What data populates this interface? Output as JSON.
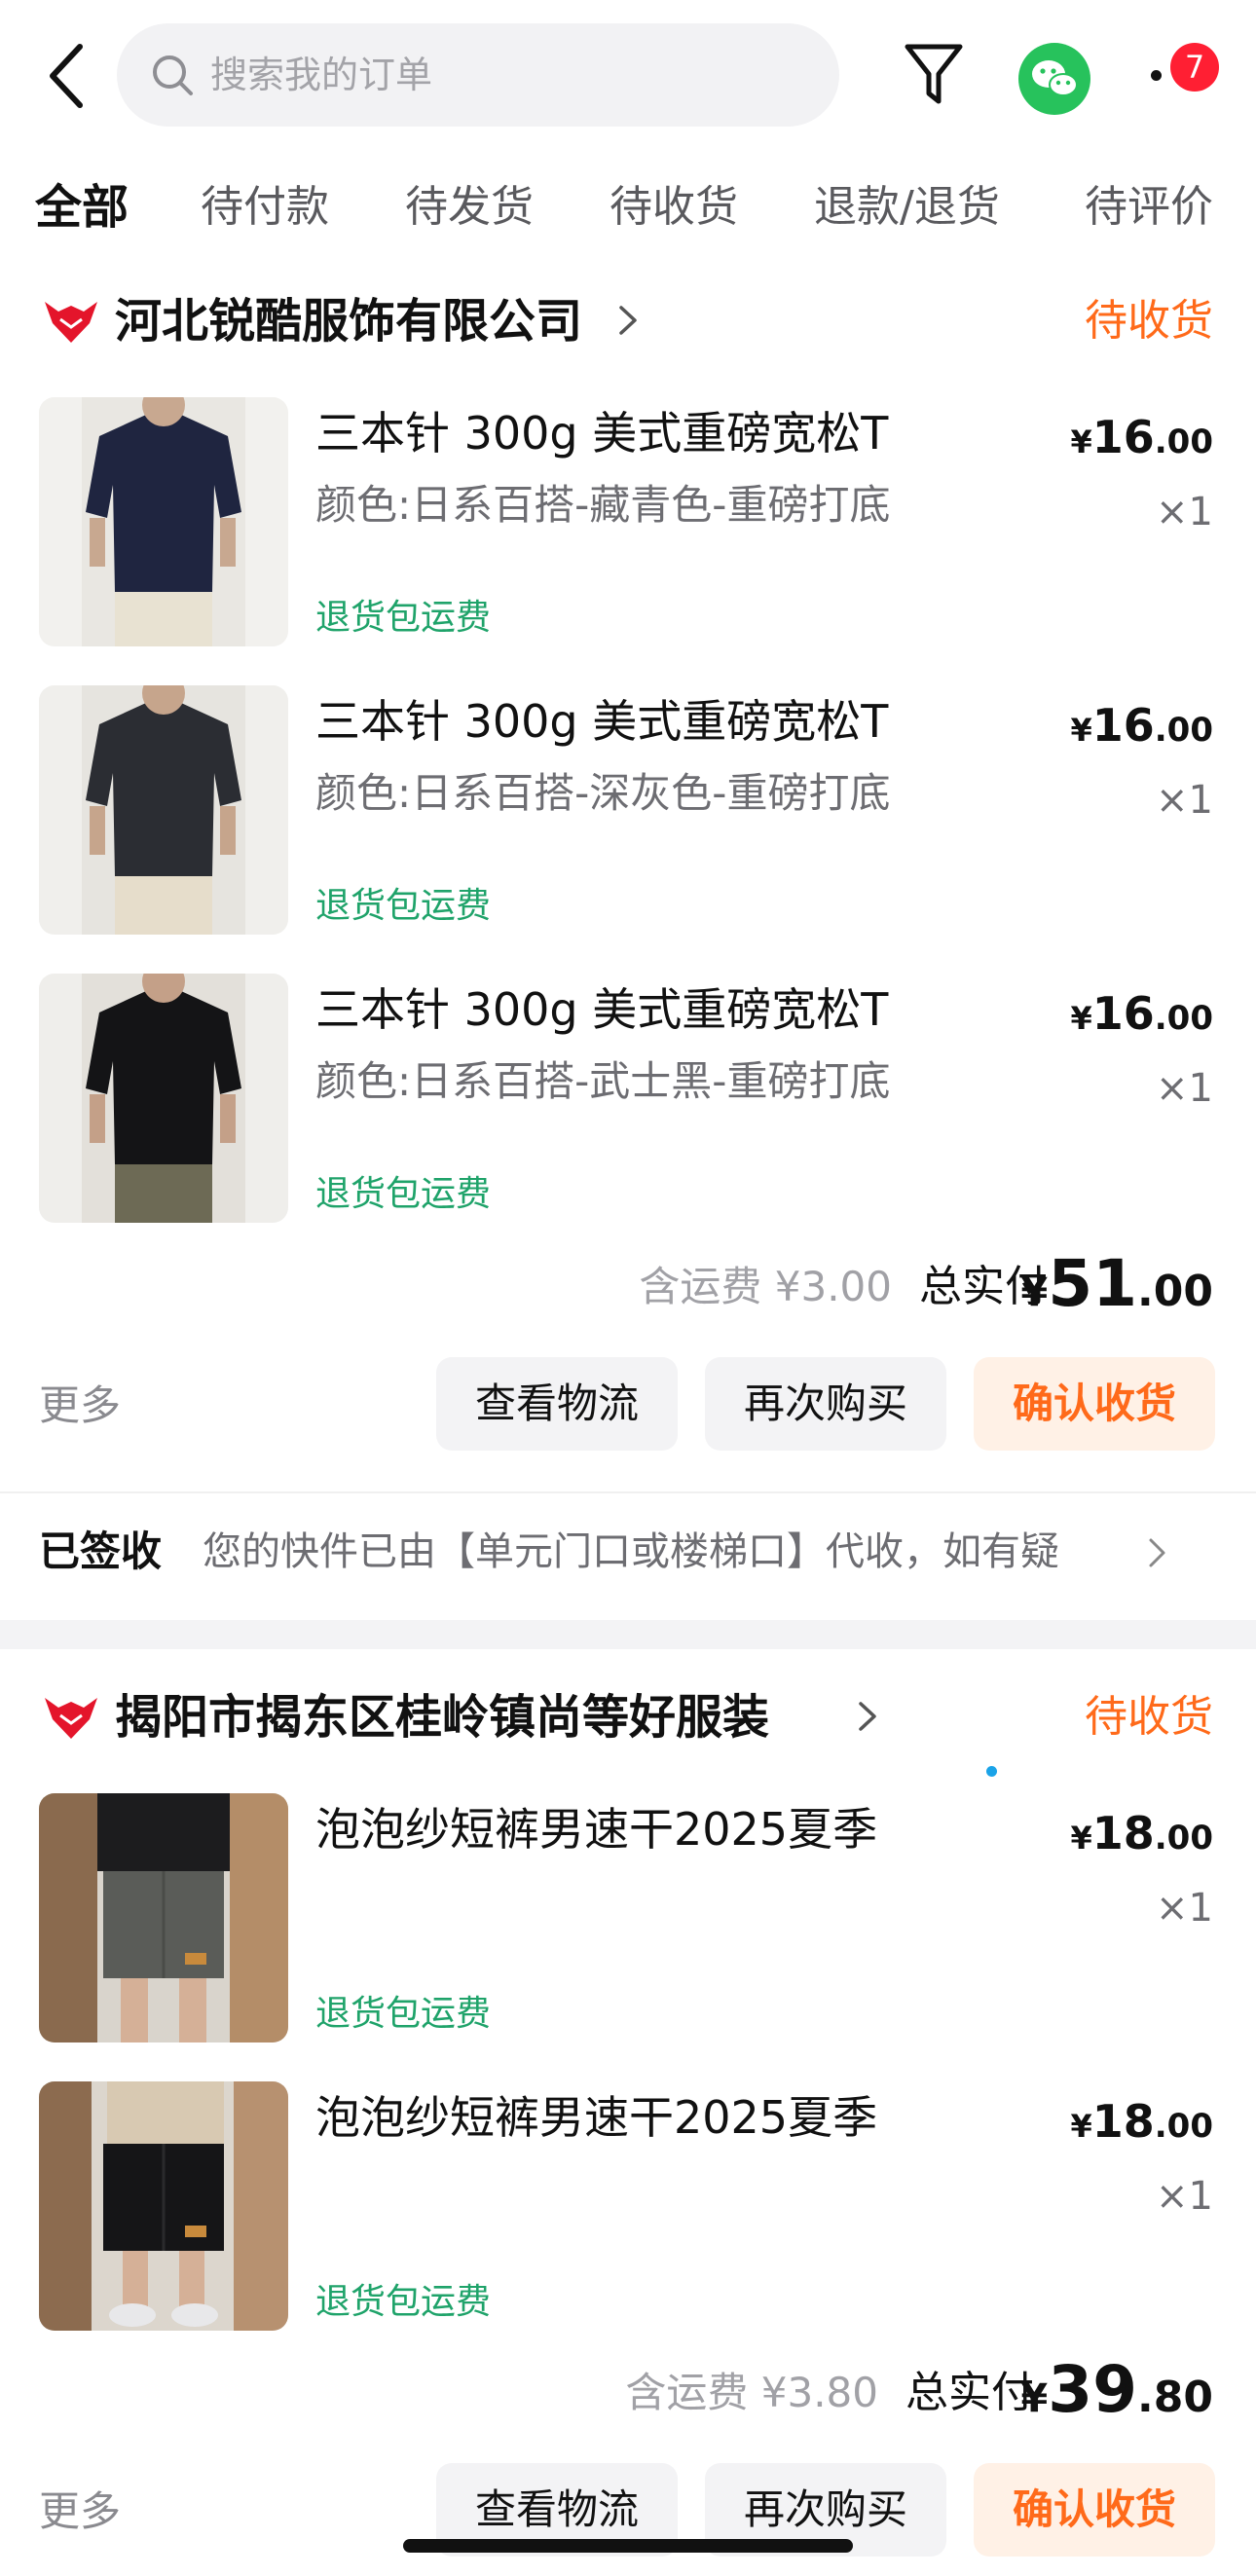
{
  "search": {
    "placeholder": "搜索我的订单"
  },
  "top_icons": [
    "back-arrow-icon",
    "search-icon",
    "filter-icon",
    "wechat-icon",
    "more-icon"
  ],
  "notification_count": "7",
  "tabs": [
    "全部",
    "待付款",
    "待发货",
    "待收货",
    "退款/退货",
    "待评价"
  ],
  "colors": {
    "accent": "#ff6a1a",
    "green_tag": "#1fa36a",
    "badge": "#ff1f33",
    "wechat": "#27c25c"
  },
  "orders": [
    {
      "shop": "河北锐酷服饰有限公司",
      "status": "待收货",
      "items": [
        {
          "title": "三本针 300g 美式重磅宽松T",
          "spec": "颜色:日系百搭-藏青色-重磅打底",
          "tag": "退货包运费",
          "price_sym": "¥",
          "price_int": "16",
          "price_dec": ".00",
          "qty": "×1"
        },
        {
          "title": "三本针 300g 美式重磅宽松T",
          "spec": "颜色:日系百搭-深灰色-重磅打底",
          "tag": "退货包运费",
          "price_sym": "¥",
          "price_int": "16",
          "price_dec": ".00",
          "qty": "×1"
        },
        {
          "title": "三本针 300g 美式重磅宽松T",
          "spec": "颜色:日系百搭-武士黑-重磅打底",
          "tag": "退货包运费",
          "price_sym": "¥",
          "price_int": "16",
          "price_dec": ".00",
          "qty": "×1"
        }
      ],
      "shipping": "含运费 ¥3.00",
      "pay_label": "总实付",
      "pay_sym": "¥",
      "pay_int": "51",
      "pay_dec": ".00",
      "more": "更多",
      "buttons": [
        "查看物流",
        "再次购买",
        "确认收货"
      ],
      "logistics_status": "已签收",
      "logistics_msg": "您的快件已由【单元门口或楼梯口】代收，如有疑"
    },
    {
      "shop": "揭阳市揭东区桂岭镇尚等好服装",
      "status": "待收货",
      "items": [
        {
          "title": "泡泡纱短裤男速干2025夏季",
          "tag": "退货包运费",
          "price_sym": "¥",
          "price_int": "18",
          "price_dec": ".00",
          "qty": "×1"
        },
        {
          "title": "泡泡纱短裤男速干2025夏季",
          "tag": "退货包运费",
          "price_sym": "¥",
          "price_int": "18",
          "price_dec": ".00",
          "qty": "×1"
        }
      ],
      "shipping": "含运费 ¥3.80",
      "pay_label": "总实付",
      "pay_sym": "¥",
      "pay_int": "39",
      "pay_dec": ".80",
      "more": "更多",
      "buttons": [
        "查看物流",
        "再次购买",
        "确认收货"
      ]
    }
  ]
}
